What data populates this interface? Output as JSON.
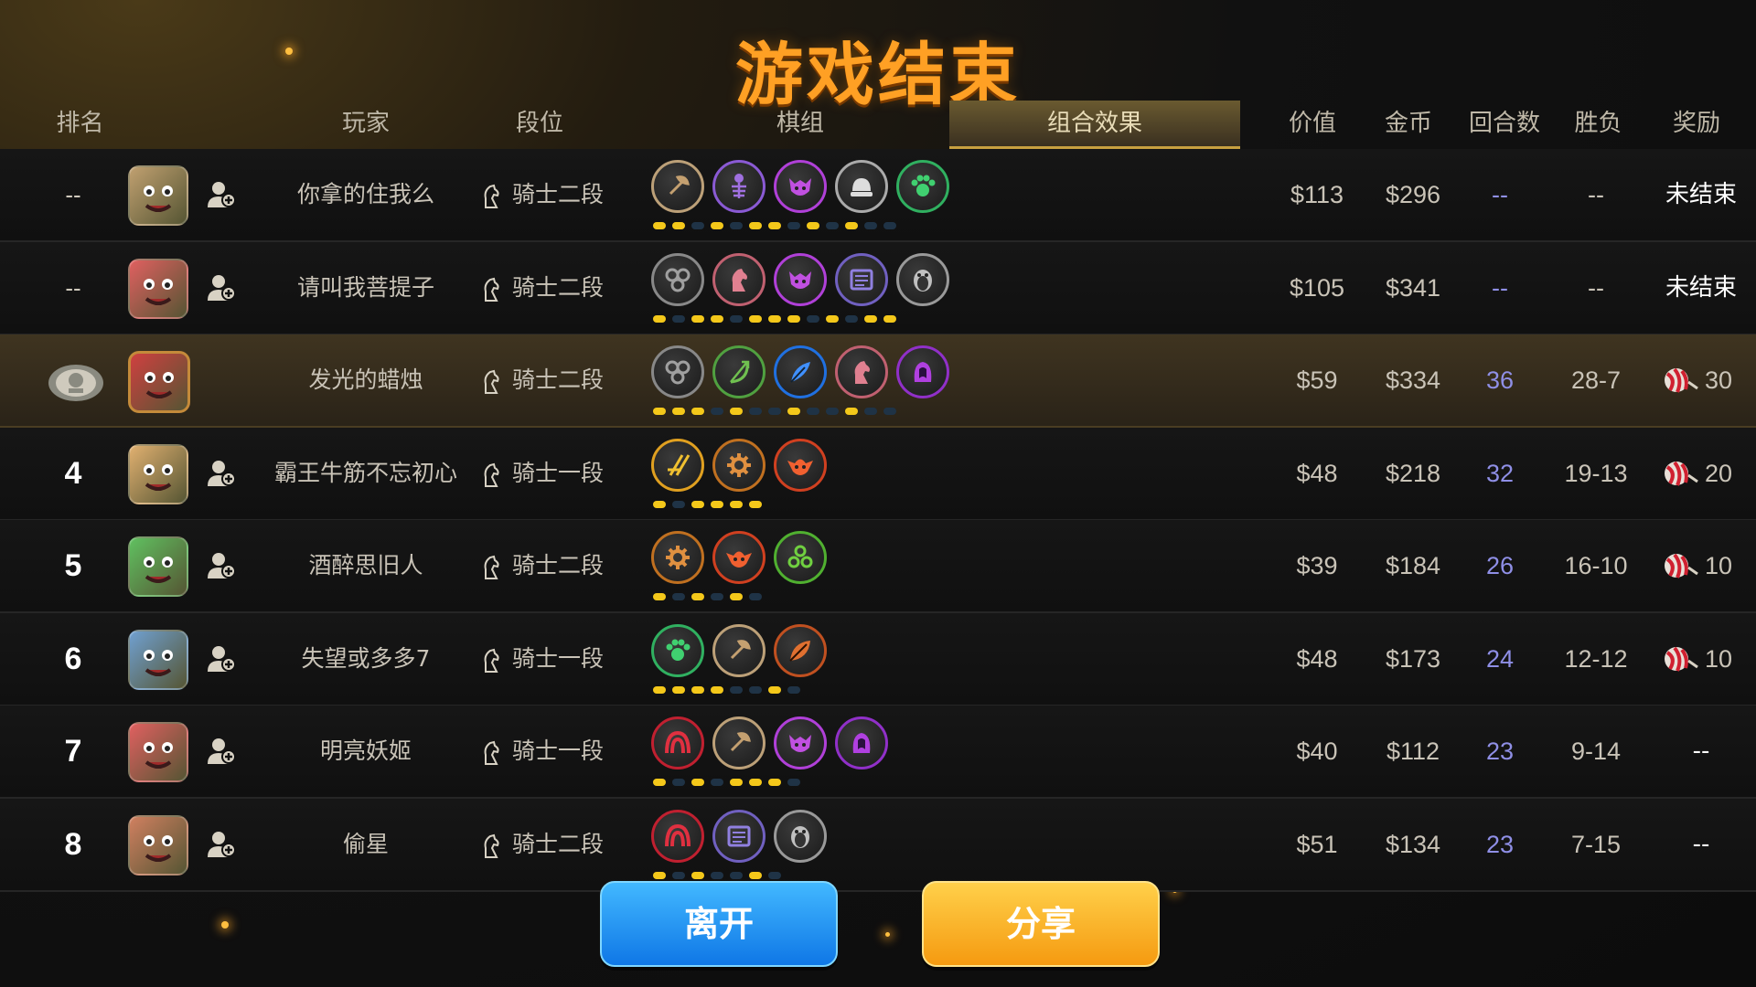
{
  "title": "游戏结束",
  "headers": {
    "rank": "排名",
    "player": "玩家",
    "duan": "段位",
    "pieces": "棋组",
    "combo": "组合效果",
    "value": "价值",
    "gold": "金币",
    "rounds": "回合数",
    "winloss": "胜负",
    "reward": "奖励"
  },
  "colors": {
    "title": "#ffa024",
    "highlight_row": "#3f3420",
    "rounds_text": "#8f8fe6",
    "dot_on": "#f4c81a",
    "dot_off": "#1f3346"
  },
  "rows": [
    {
      "rank": "--",
      "name": "你拿的住我么",
      "duan": "骑士二段",
      "value": "$113",
      "gold": "$296",
      "rounds": "--",
      "winloss": "--",
      "reward_text": "未结束",
      "reward_num": "",
      "has_reward_icon": false,
      "highlight": false,
      "avatar_color": "#c0a070",
      "has_add_icon": true,
      "pieces": [
        {
          "icon": "axe-icon",
          "color": "#c4a070",
          "border": "#bca078"
        },
        {
          "icon": "skeleton-icon",
          "color": "#a070e0",
          "border": "#8a5ad4"
        },
        {
          "icon": "demon-icon",
          "color": "#c050e0",
          "border": "#b040d8"
        },
        {
          "icon": "helmet-icon",
          "color": "#dddddd",
          "border": "#aaaaaa"
        },
        {
          "icon": "paw-icon",
          "color": "#40d070",
          "border": "#30b060"
        }
      ],
      "dots": [
        1,
        1,
        0,
        1,
        0,
        1,
        1,
        0,
        1,
        0,
        1,
        0,
        0
      ]
    },
    {
      "rank": "--",
      "name": "请叫我菩提子",
      "duan": "骑士二段",
      "value": "$105",
      "gold": "$341",
      "rounds": "--",
      "winloss": "--",
      "reward_text": "未结束",
      "reward_num": "",
      "has_reward_icon": false,
      "highlight": false,
      "avatar_color": "#e06060",
      "has_add_icon": true,
      "pieces": [
        {
          "icon": "gear-cluster-icon",
          "color": "#a0a0a0",
          "border": "#888888"
        },
        {
          "icon": "knight-icon",
          "color": "#e08090",
          "border": "#c06070"
        },
        {
          "icon": "demon-icon",
          "color": "#c050e0",
          "border": "#b040d8"
        },
        {
          "icon": "book-icon",
          "color": "#9080e0",
          "border": "#7060c0"
        },
        {
          "icon": "penguin-icon",
          "color": "#c0c0c0",
          "border": "#999999"
        }
      ],
      "dots": [
        1,
        0,
        1,
        1,
        0,
        1,
        1,
        1,
        0,
        1,
        0,
        1,
        1
      ]
    },
    {
      "rank": "",
      "name": "发光的蜡烛",
      "duan": "骑士二段",
      "value": "$59",
      "gold": "$334",
      "rounds": "36",
      "winloss": "28-7",
      "reward_text": "",
      "reward_num": "30",
      "has_reward_icon": true,
      "highlight": true,
      "avatar_color": "#d04040",
      "has_add_icon": false,
      "pieces": [
        {
          "icon": "gear-cluster-icon",
          "color": "#a0a0a0",
          "border": "#888888"
        },
        {
          "icon": "bow-icon",
          "color": "#70c050",
          "border": "#50a040"
        },
        {
          "icon": "feather-icon",
          "color": "#4090ff",
          "border": "#2070e0"
        },
        {
          "icon": "knight-icon",
          "color": "#e08090",
          "border": "#c06070"
        },
        {
          "icon": "hood-icon",
          "color": "#b040e0",
          "border": "#9030c8"
        }
      ],
      "dots": [
        1,
        1,
        1,
        0,
        1,
        0,
        0,
        1,
        0,
        0,
        1,
        0,
        0
      ]
    },
    {
      "rank": "4",
      "name": "霸王牛筋不忘初心",
      "duan": "骑士一段",
      "value": "$48",
      "gold": "$218",
      "rounds": "32",
      "winloss": "19-13",
      "reward_text": "",
      "reward_num": "20",
      "has_reward_icon": true,
      "highlight": false,
      "avatar_color": "#e0b070",
      "has_add_icon": true,
      "pieces": [
        {
          "icon": "blades-icon",
          "color": "#f0c030",
          "border": "#e0a020"
        },
        {
          "icon": "cog-icon",
          "color": "#e09040",
          "border": "#c07020"
        },
        {
          "icon": "goblin-icon",
          "color": "#f06030",
          "border": "#d04020"
        }
      ],
      "dots": [
        1,
        0,
        1,
        1,
        1,
        1
      ]
    },
    {
      "rank": "5",
      "name": "酒醉思旧人",
      "duan": "骑士二段",
      "value": "$39",
      "gold": "$184",
      "rounds": "26",
      "winloss": "16-10",
      "reward_text": "",
      "reward_num": "10",
      "has_reward_icon": true,
      "highlight": false,
      "avatar_color": "#60c060",
      "has_add_icon": true,
      "pieces": [
        {
          "icon": "cog-icon",
          "color": "#e09040",
          "border": "#c07020"
        },
        {
          "icon": "goblin-icon",
          "color": "#f06030",
          "border": "#d04020"
        },
        {
          "icon": "triad-icon",
          "color": "#70d040",
          "border": "#50b030"
        }
      ],
      "dots": [
        1,
        0,
        1,
        0,
        1,
        0
      ]
    },
    {
      "rank": "6",
      "name": "失望或多多7",
      "duan": "骑士一段",
      "value": "$48",
      "gold": "$173",
      "rounds": "24",
      "winloss": "12-12",
      "reward_text": "",
      "reward_num": "10",
      "has_reward_icon": true,
      "highlight": false,
      "avatar_color": "#70a0d0",
      "has_add_icon": true,
      "pieces": [
        {
          "icon": "paw-icon",
          "color": "#40d070",
          "border": "#30b060"
        },
        {
          "icon": "axe-icon",
          "color": "#c4a070",
          "border": "#bca078"
        },
        {
          "icon": "leaf-icon",
          "color": "#e07030",
          "border": "#c05020"
        }
      ],
      "dots": [
        1,
        1,
        1,
        1,
        0,
        0,
        1,
        0
      ]
    },
    {
      "rank": "7",
      "name": "明亮妖姬",
      "duan": "骑士一段",
      "value": "$40",
      "gold": "$112",
      "rounds": "23",
      "winloss": "9-14",
      "reward_text": "--",
      "reward_num": "",
      "has_reward_icon": false,
      "highlight": false,
      "avatar_color": "#e06060",
      "has_add_icon": true,
      "pieces": [
        {
          "icon": "arch-icon",
          "color": "#e03040",
          "border": "#c02030"
        },
        {
          "icon": "axe-icon",
          "color": "#c4a070",
          "border": "#bca078"
        },
        {
          "icon": "demon-icon",
          "color": "#c050e0",
          "border": "#b040d8"
        },
        {
          "icon": "hood-icon",
          "color": "#b040e0",
          "border": "#9030c8"
        }
      ],
      "dots": [
        1,
        0,
        1,
        0,
        1,
        1,
        1,
        0
      ]
    },
    {
      "rank": "8",
      "name": "偷星",
      "duan": "骑士二段",
      "value": "$51",
      "gold": "$134",
      "rounds": "23",
      "winloss": "7-15",
      "reward_text": "--",
      "reward_num": "",
      "has_reward_icon": false,
      "highlight": false,
      "avatar_color": "#d08060",
      "has_add_icon": true,
      "pieces": [
        {
          "icon": "arch-icon",
          "color": "#e03040",
          "border": "#c02030"
        },
        {
          "icon": "book-icon",
          "color": "#9080e0",
          "border": "#7060c0"
        },
        {
          "icon": "penguin-icon",
          "color": "#c0c0c0",
          "border": "#999999"
        }
      ],
      "dots": [
        1,
        0,
        1,
        0,
        0,
        1,
        0
      ]
    }
  ],
  "buttons": {
    "leave": "离开",
    "share": "分享"
  }
}
